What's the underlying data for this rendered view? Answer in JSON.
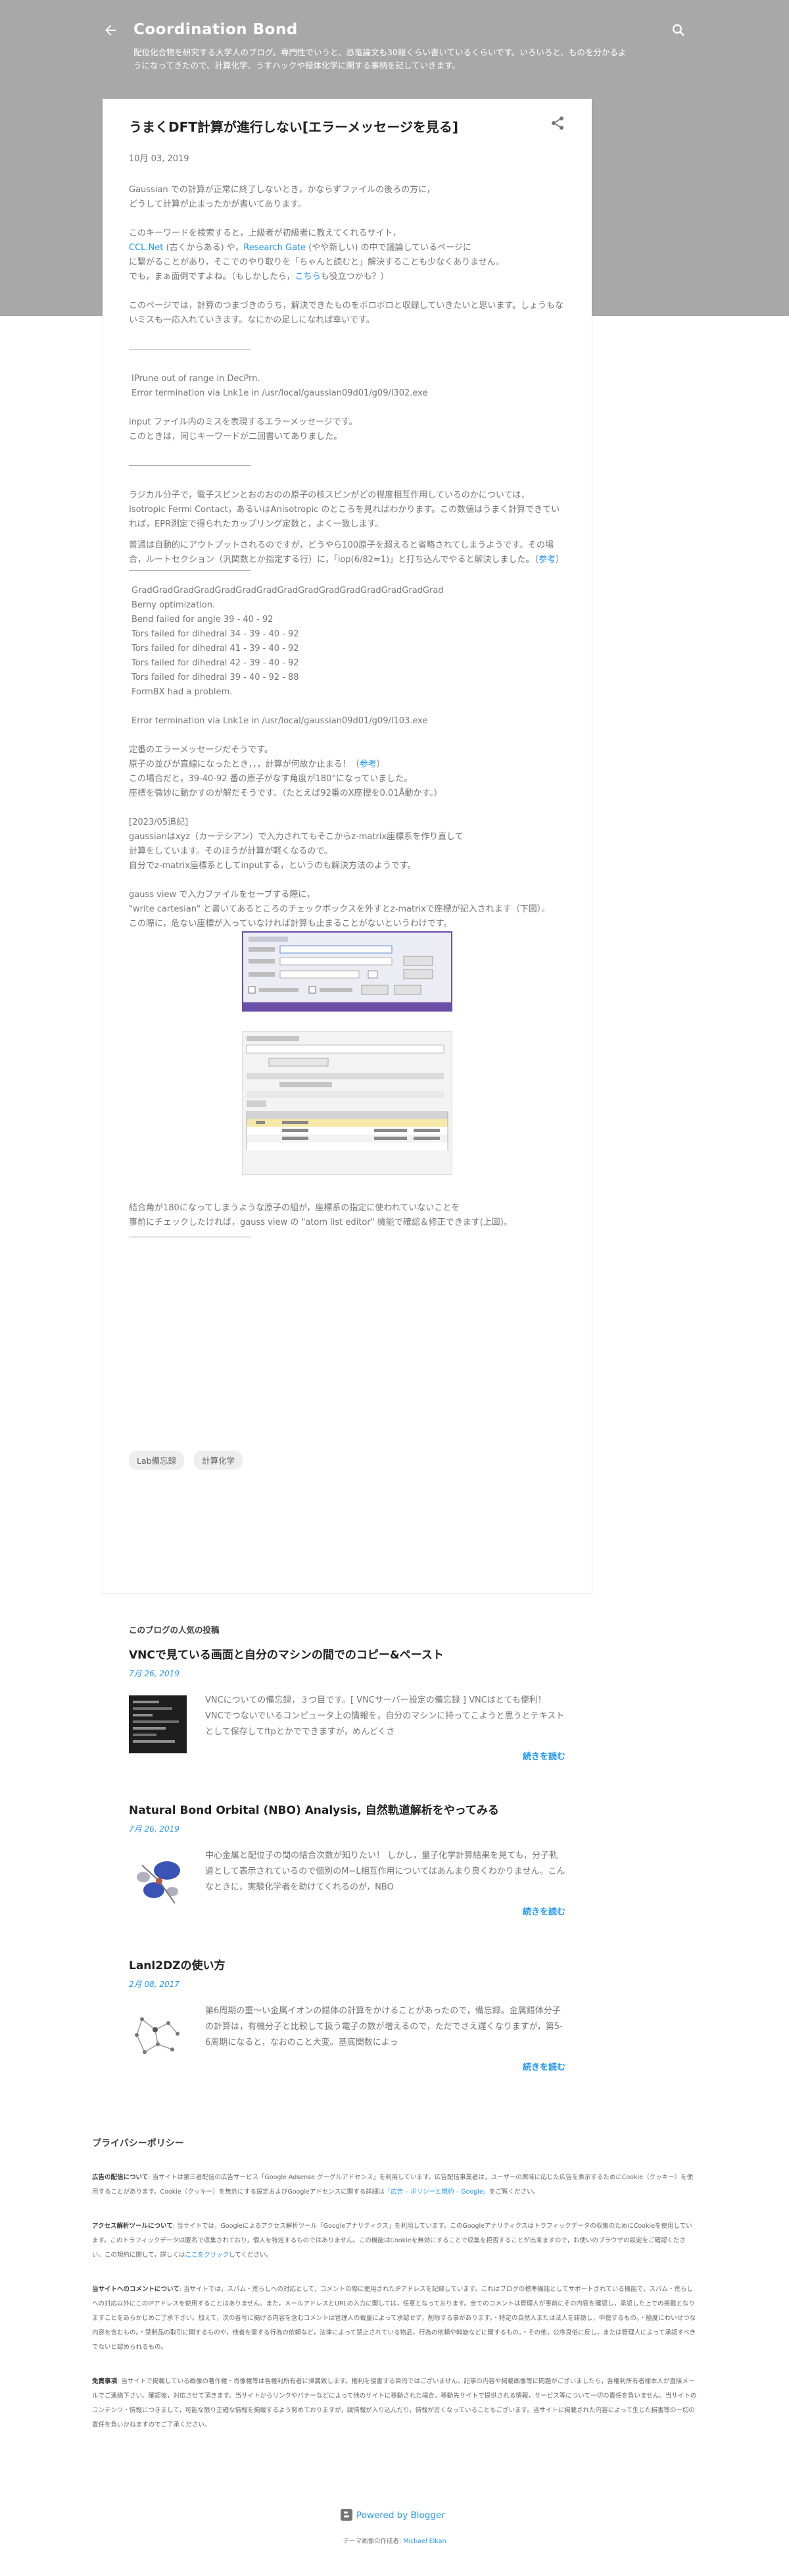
{
  "header": {
    "title": "Coordination Bond",
    "description": "配位化合物を研究する大学人のブログ。専門性でいうと、恐竜論文も30報くらい書いているくらいです。いろいろと、ものを分かるようになってきたので、計算化学、うすハックや錯体化学に関する事柄を記していきます。",
    "back_icon": "arrow-back-icon",
    "search_icon": "search-icon"
  },
  "post": {
    "title": "うまくDFT計算が進行しない[エラーメッセージを見る]",
    "date": "10月 03, 2019",
    "share_icon": "share-icon",
    "body": {
      "intro1": "Gaussian での計算が正常に終了しないとき，かならずファイルの後ろの方に，",
      "intro2": "どうして計算が止まったかが書いてあります。",
      "search1": "このキーワードを検索すると，上級者が初級者に教えてくれるサイト，",
      "search2_pre": "",
      "search2_link1": "CCL.Net",
      "search2_mid": " (古くからある) や，",
      "search2_link2": "Research Gate",
      "search2_post": " (やや新しい) の中で議論しているページに",
      "search3": "に繋がることがあり，そこでのやり取りを「ちゃんと読むと」解決することも少なくありません。",
      "search4_pre": "でも，まぁ面倒ですよね。（もしかしたら，",
      "search4_link": "こちら",
      "search4_post": "も役立つかも？）",
      "list1": "このページでは，計算のつまづきのうち，解決できたものをボロボロと収録していきたいと思います。しょうもないミスも一応入れていきます。なにかの足しになれば幸いです。",
      "err1_a": " IPrune out of range in DecPrn.",
      "err1_b": " Error termination via Lnk1e in /usr/local/gaussian09d01/g09/l302.exe",
      "err1_c": "input ファイル内のミスを表現するエラーメッセージです。",
      "err1_d": "このときは，同じキーワードが二回書いてありました。",
      "rad1": "ラジカル分子で，電子スピンとおのおのの原子の核スピンがどの程度相互作用しているのかについては，Isotropic Fermi Contact，あるいはAnisotropic のところを見ればわかります。この数値はうまく計算できていれば，EPR測定で得られたカップリング定数と，よく一致します。",
      "rad2_pre": "普通は自動的にアウトプットされるのですが，どうやら100原子を超えると省略されてしまうようです。その場合，ルートセクション（汎関数とか指定する行）に，「iop(6/82=1)」と打ち込んでやると解決しました。（",
      "rad2_link": "参考",
      "rad2_post": "）",
      "code_lines": [
        "GradGradGradGradGradGradGradGradGradGradGradGradGradGradGrad",
        "Berny optimization.",
        "Bend failed for angle   39 -  40 -  92",
        "Tors failed for dihedral   34 -  39 -  40 -  92",
        "Tors failed for dihedral   41 -  39 -  40 -  92",
        "Tors failed for dihedral   42 -  39 -  40 -  92",
        "Tors failed for dihedral   39 -  40 -  92 -  88",
        "FormBX had a problem.",
        "",
        "Error termination via Lnk1e in /usr/local/gaussian09d01/g09/l103.exe"
      ],
      "def1": "定番のエラーメッセージだそうです。",
      "def2_pre": "原子の並びが直線になったとき，，，計算が何故か止まる！（",
      "def2_link": "参考",
      "def2_post": "）",
      "def3": "この場合だと，39-40-92 番の原子がなす角度が180°になっていました。",
      "def4": "座標を微妙に動かすのが解だそうです。（たとえば92番のX座標を0.01Å動かす。）",
      "add1": "[2023/05追記]",
      "add2": "gaussianはxyz（カーテシアン）で入力されてもそこからz-matrix座標系を作り直して",
      "add3": "計算をしています。そのほうが計算が軽くなるので。",
      "add4": "自分でz-matrix座標系としてinputする，というのも解決方法のようです。",
      "gv1": "gauss view で入力ファイルをセーブする際に，",
      "gv2": "\"write cartesian\" と書いてあるところのチェックボックスを外すとz-matrixで座標が記入されます（下図）。",
      "gv3": "この際に，危ない座標が入っていなければ計算も止まることがないというわけです。",
      "tail1": "結合角が180になってしまうような原子の組が，座標系の指定に使われていないことを",
      "tail2": "事前にチェックしたければ，gauss view の \"atom list editor\" 機能で確認＆修正できます(上図)。"
    },
    "labels": [
      "Lab備忘録",
      "計算化学"
    ]
  },
  "popular": {
    "heading": "このブログの人気の投稿",
    "items": [
      {
        "title": "VNCで見ている画面と自分のマシンの間でのコピー&ペースト",
        "date": "7月 26, 2019",
        "snippet": "VNCについての備忘録，３つ目です。[ VNCサーバー設定の備忘録 ] VNCはとても便利！ VNCでつないでいるコンピュータ上の情報を，自分のマシンに持ってこようと思うとテキストとして保存してftpとかでできますが，めんどくさ",
        "more": "続きを読む",
        "thumb_icon": "terminal-thumbnail-icon"
      },
      {
        "title": "Natural Bond Orbital (NBO) Analysis, 自然軌道解析をやってみる",
        "date": "7月 26, 2019",
        "snippet": "中心金属と配位子の間の結合次数が知りたい！ しかし，量子化学計算結果を見ても，分子軌道として表示されているので個別のM−L相互作用についてはあんまり良くわかりません。こんなときに，実験化学者を助けてくれるのが，NBO",
        "more": "続きを読む",
        "thumb_icon": "orbital-thumbnail-icon"
      },
      {
        "title": "Lanl2DZの使い方",
        "date": "2月 08, 2017",
        "snippet": "第6周期の重〜い金属イオンの錯体の計算をかけることがあったので，備忘録。金属錯体分子の計算は，有機分子と比較して扱う電子の数が増えるので，ただでさえ遅くなりますが，第5-6周期になると，なおのこと大変。基底関数によっ",
        "more": "続きを読む",
        "thumb_icon": "molecule-thumbnail-icon"
      }
    ]
  },
  "privacy": {
    "heading": "プライバシーポリシー",
    "p1_label": "広告の配信について",
    "p1_text": ": 当サイトは第三者配信の広告サービス「Google Adsense グーグルアドセンス」を利用しています。広告配信事業者は，ユーザーの興味に応じた広告を表示するためにCookie（クッキー）を使用することがあります。Cookie（クッキー）を無効にする設定およびGoogleアドセンスに関する詳細は",
    "p1_link": "「広告 – ポリシーと規約 – Google」",
    "p1_end": "をご覧ください。",
    "p2_label": "アクセス解析ツールについて",
    "p2_text": ": 当サイトでは，Googleによるアクセス解析ツール「Googleアナリティクス」を利用しています。このGoogleアナリティクスはトラフィックデータの収集のためにCookieを使用しています。このトラフィックデータは匿名で収集されており，個人を特定するものではありません。この機能はCookieを無効にすることで収集を拒否することが出来ますので，お使いのブラウザの設定をご確認ください。この規約に関して，詳しくは",
    "p2_link": "ここをクリック",
    "p2_end": "してください。",
    "p3_label": "当サイトへのコメントについて",
    "p3_text": ": 当サイトでは，スパム・荒らしへの対応として，コメントの際に使用されたIPアドレスを記録しています。これはブログの標準機能としてサポートされている機能で，スパム・荒らしへの対応以外にこのIPアドレスを使用することはありません。また，メールアドレスとURLの入力に関しては，任意となっております。全てのコメントは管理人が事前にその内容を確認し，承認した上での掲載となりますことをあらかじめご了承下さい。加えて，次の各号に掲げる内容を含むコメントは管理人の裁量によって承認せず，削除する事があります。・特定の自然人または法人を誹謗し，中傷するもの。・極度にわいせつな内容を含むもの。・禁制品の取引に関するものや，他者を害する行為の依頼など，法律によって禁止されている物品，行為の依頼や斡旋などに関するもの。・その他，公序良俗に反し，または管理人によって承認すべきでないと認められるもの。",
    "p4_label": "免責事項",
    "p4_text": ": 当サイトで掲載している画像の著作権・肖像権等は各権利所有者に帰属致します。権利を侵害する目的ではございません。記事の内容や掲載画像等に問題がございましたら，各権利所有者様本人が直接メールでご連絡下さい。確認後，対応させて頂きます。当サイトからリンクやバナーなどによって他のサイトに移動された場合，移動先サイトで提供される情報，サービス等について一切の責任を負いません。当サイトのコンテンツ・情報につきまして，可能な限り正確な情報を掲載するよう努めておりますが，誤情報が入り込んだり，情報が古くなっていることもございます。当サイトに掲載された内容によって生じた損害等の一切の責任を負いかねますのでご了承ください。"
  },
  "footer": {
    "powered_by": "Powered by Blogger",
    "theme_prefix": "テーマ画像の作成者: ",
    "theme_author": "Michael Elkan",
    "blogger_icon": "blogger-icon"
  },
  "colors": {
    "header_bg": "#a8a8a8",
    "link": "#2196f3",
    "title": "#212121"
  }
}
